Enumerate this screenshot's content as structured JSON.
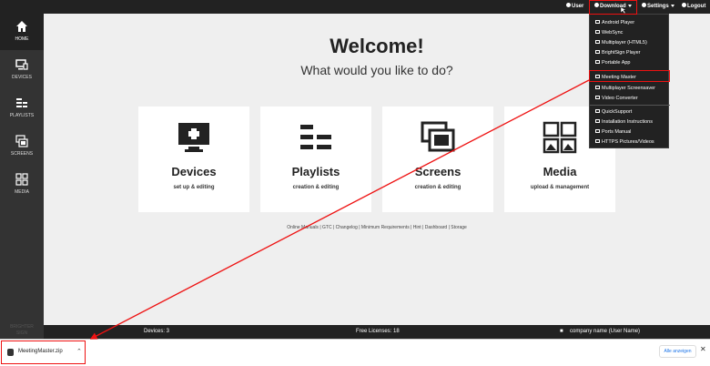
{
  "topbar": {
    "user": "User",
    "download": "Download",
    "settings": "Settings",
    "logout": "Logout"
  },
  "sidebar": {
    "items": [
      {
        "label": "HOME",
        "icon": "home-icon"
      },
      {
        "label": "DEVICES",
        "icon": "devices-icon"
      },
      {
        "label": "PLAYLISTS",
        "icon": "playlists-icon"
      },
      {
        "label": "SCREENS",
        "icon": "screens-icon"
      },
      {
        "label": "MEDIA",
        "icon": "media-icon"
      }
    ],
    "footer_line1": "BRIGHTER",
    "footer_line2": "SIGN"
  },
  "main": {
    "welcome": "Welcome!",
    "subtitle": "What would you like to do?",
    "cards": [
      {
        "title": "Devices",
        "sub": "set up & editing"
      },
      {
        "title": "Playlists",
        "sub": "creation & editing"
      },
      {
        "title": "Screens",
        "sub": "creation & editing"
      },
      {
        "title": "Media",
        "sub": "upload & management"
      }
    ],
    "links": "Online Manuals | GTC | Changelog | Minimum Requirements | Hint | Dashboard | Storage"
  },
  "statusbar": {
    "devices": "Devices: 3",
    "licenses": "Free Licenses: 18",
    "company": "company name (User Name)"
  },
  "menu": {
    "items": [
      "Android Player",
      "WebSync",
      "Multiplayer (HTML5)",
      "BrightSign Player",
      "Portable App",
      "Meeting Master",
      "Multiplayer Screensaver",
      "Video Converter",
      "QuickSupport",
      "Installation Instructions",
      "Ports Manual",
      "HTTPS Pictures/Videos"
    ]
  },
  "downloads": {
    "file": "MeetingMaster.zip",
    "show_all": "Alle anzeigen"
  },
  "colors": {
    "highlight": "#ee1111",
    "topbar": "#222222",
    "sidebar": "#333333"
  }
}
